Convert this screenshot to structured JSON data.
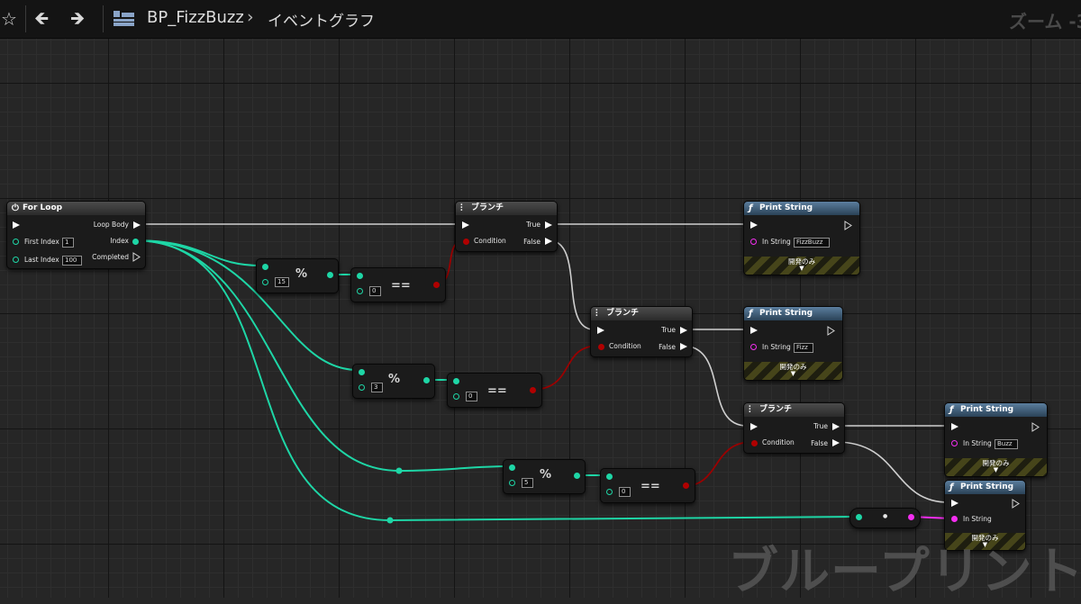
{
  "toolbar": {
    "blueprint_name": "BP_FizzBuzz",
    "graph_name": "イベントグラフ",
    "zoom_text": "ズーム -3"
  },
  "watermark": "ブループリント",
  "nodes": {
    "for_loop": {
      "title": "For Loop",
      "loop_body": "Loop Body",
      "first_index": "First Index",
      "first_index_value": "1",
      "last_index": "Last Index",
      "last_index_value": "100",
      "index": "Index",
      "completed": "Completed"
    },
    "mod15": {
      "op": "%",
      "value": "15"
    },
    "eq15": {
      "op": "==",
      "value": "0"
    },
    "mod3": {
      "op": "%",
      "value": "3"
    },
    "eq3": {
      "op": "==",
      "value": "0"
    },
    "mod5": {
      "op": "%",
      "value": "5"
    },
    "eq5": {
      "op": "==",
      "value": "0"
    },
    "branch1": {
      "title": "ブランチ",
      "cond": "Condition",
      "true": "True",
      "false": "False"
    },
    "branch2": {
      "title": "ブランチ",
      "cond": "Condition",
      "true": "True",
      "false": "False"
    },
    "branch3": {
      "title": "ブランチ",
      "cond": "Condition",
      "true": "True",
      "false": "False"
    },
    "print_fizzbuzz": {
      "title": "Print String",
      "in_string": "In String",
      "value": "FizzBuzz",
      "dev_only": "開発のみ"
    },
    "print_fizz": {
      "title": "Print String",
      "in_string": "In String",
      "value": "Fizz",
      "dev_only": "開発のみ"
    },
    "print_buzz": {
      "title": "Print String",
      "in_string": "In String",
      "value": "Buzz",
      "dev_only": "開発のみ"
    },
    "print_index": {
      "title": "Print String",
      "in_string": "In String",
      "dev_only": "開発のみ"
    },
    "to_string": {
      "label": "●"
    }
  },
  "colors": {
    "integer_wire": "#1ed6a6",
    "bool_wire": "#b00000",
    "string_wire": "#f42ef0",
    "exec_wire": "#d0d0d0",
    "function_title": "#4f7596"
  }
}
